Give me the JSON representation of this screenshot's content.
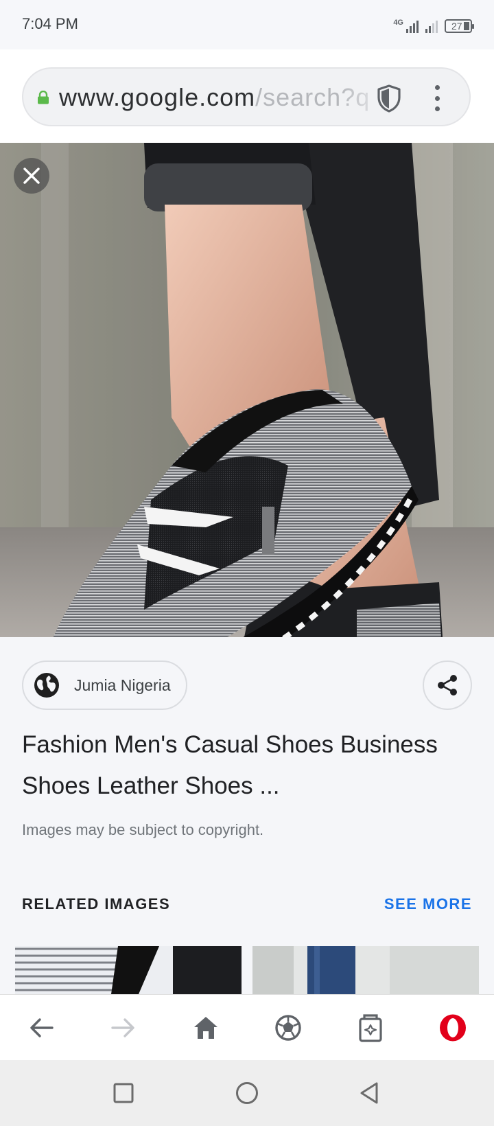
{
  "status_bar": {
    "time": "7:04 PM",
    "network_label": "4G",
    "battery": "27"
  },
  "address_bar": {
    "url_host": "www.google.com",
    "url_path": "/search?q",
    "icons": [
      "lock-icon",
      "shield-icon",
      "more-vert-icon"
    ]
  },
  "image_view": {
    "close_icon": "close-icon"
  },
  "result": {
    "source_name": "Jumia Nigeria",
    "title": "Fashion Men's Casual Shoes Business Shoes Leather Shoes ...",
    "copyright_note": "Images may be subject to copyright."
  },
  "related": {
    "header": "RELATED IMAGES",
    "see_more": "SEE MORE"
  },
  "toolbar": {
    "icons": [
      "back-arrow-icon",
      "forward-arrow-icon",
      "home-icon",
      "soccer-ball-icon",
      "tabs-icon",
      "opera-icon"
    ]
  },
  "system_nav": {
    "icons": [
      "recents-square-icon",
      "home-circle-icon",
      "back-triangle-icon"
    ]
  },
  "colors": {
    "accent_link": "#1a73e8",
    "opera_red": "#e2001a",
    "lock_green": "#5bb94a"
  }
}
